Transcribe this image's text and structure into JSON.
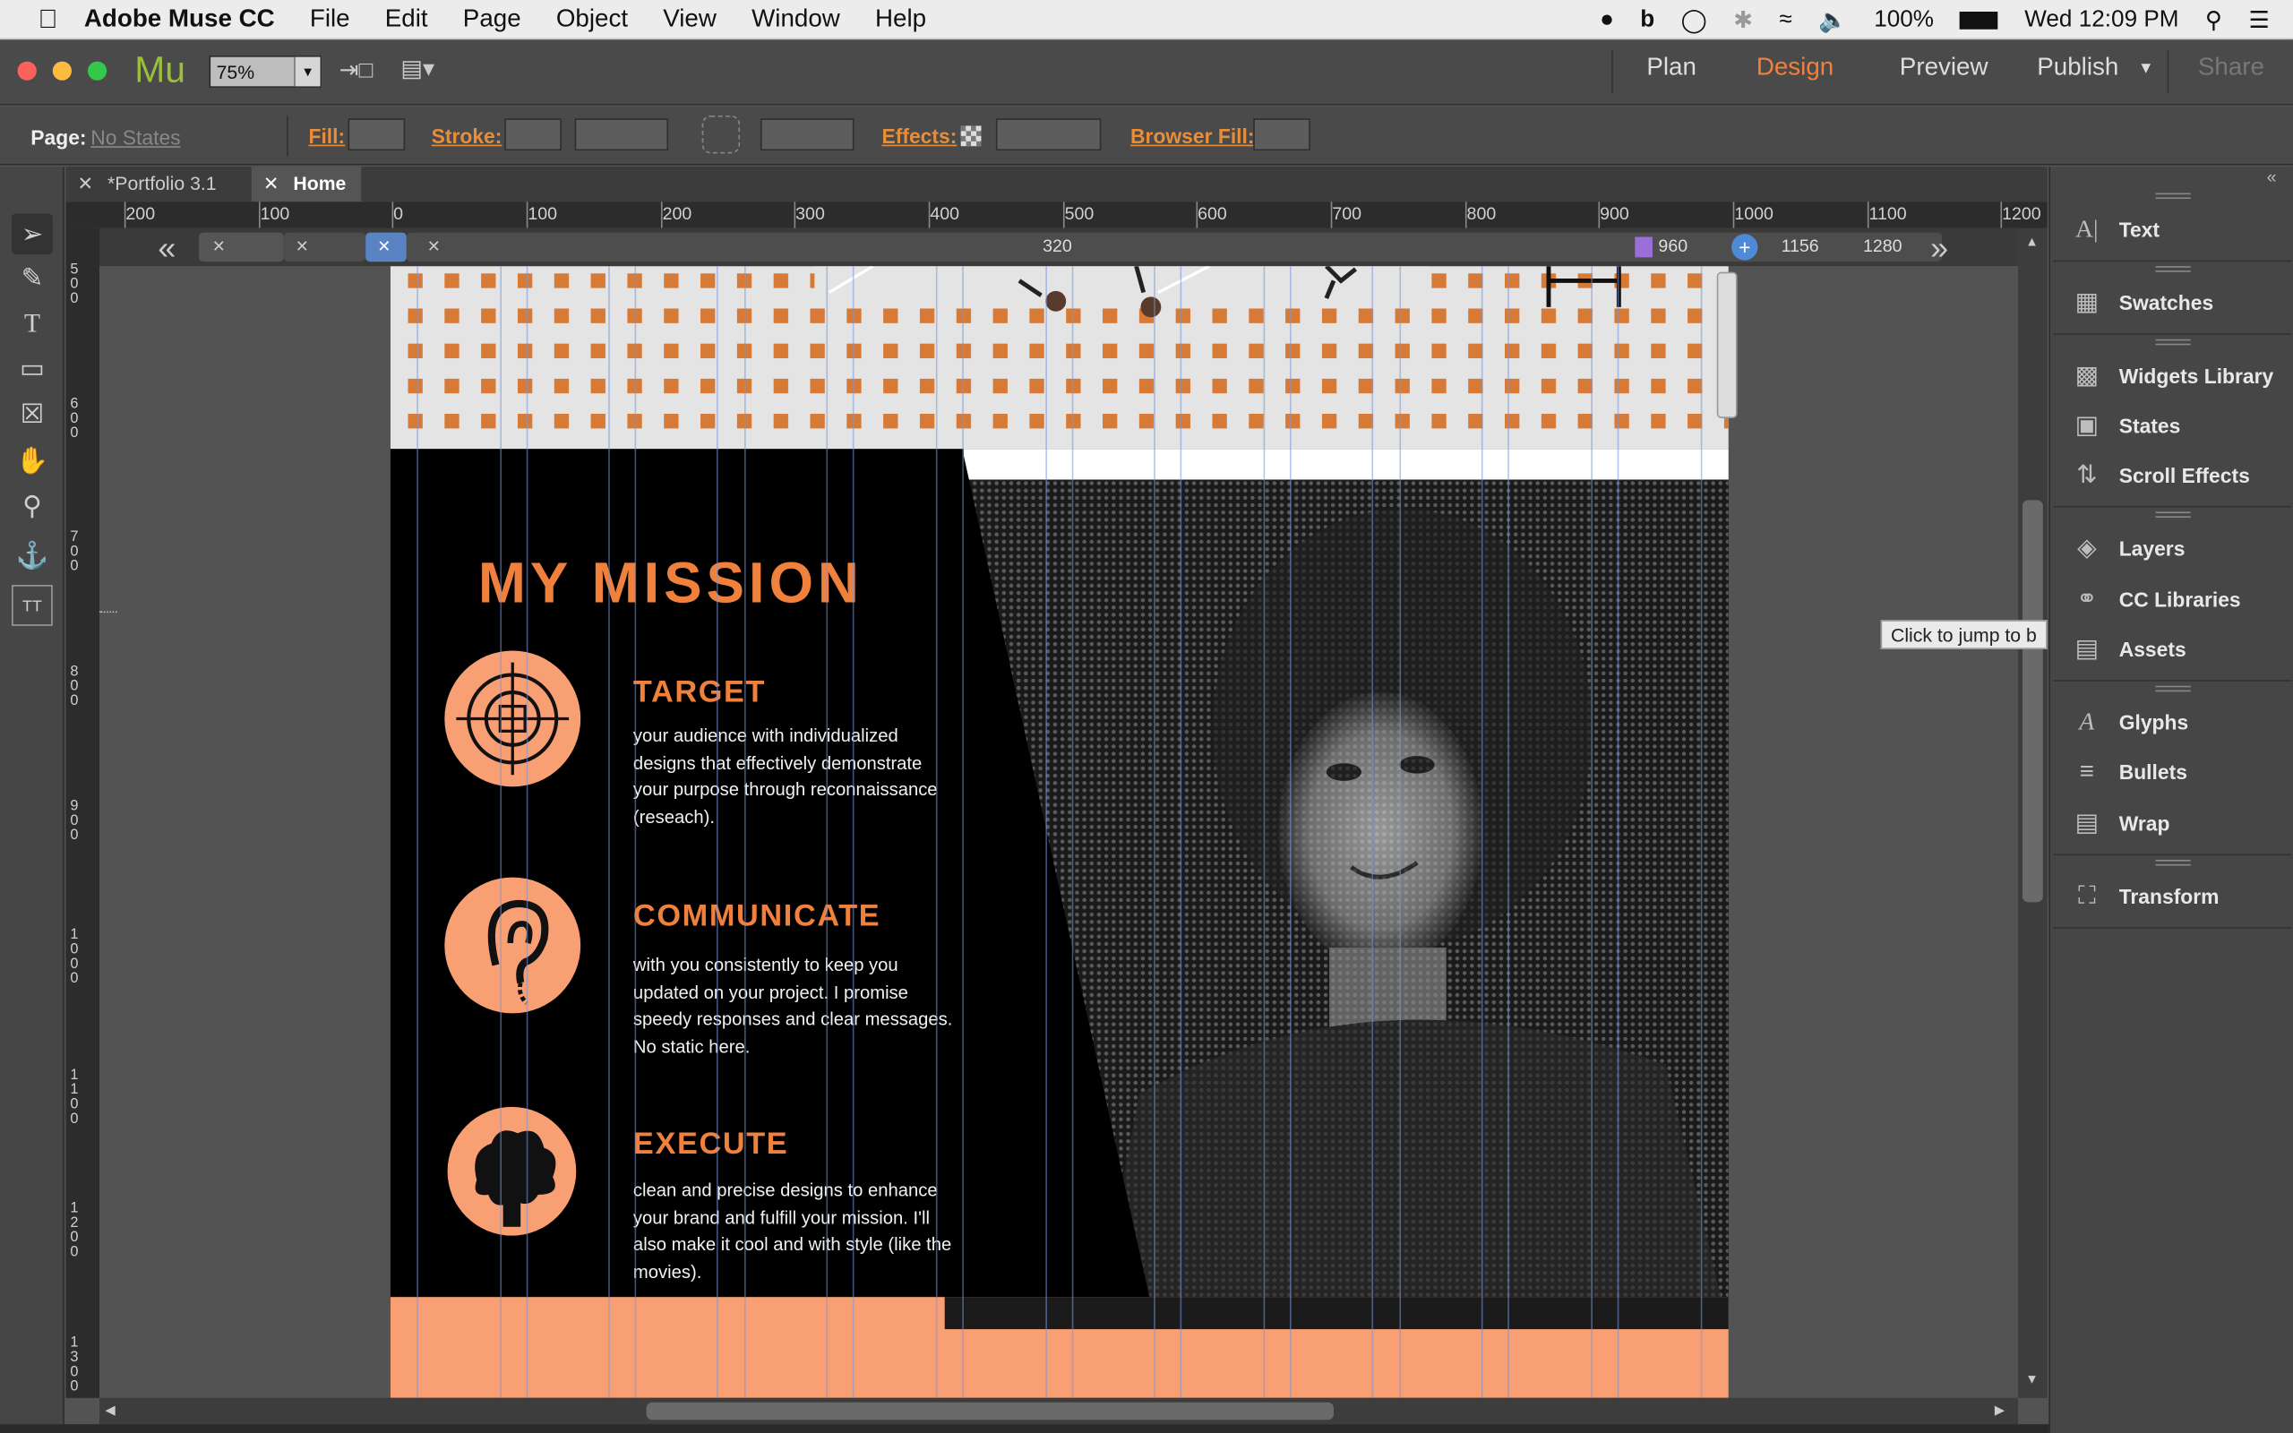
{
  "menubar": {
    "app_name": "Adobe Muse CC",
    "menus": [
      "File",
      "Edit",
      "Page",
      "Object",
      "View",
      "Window",
      "Help"
    ],
    "battery": "100%",
    "clock": "Wed 12:09 PM"
  },
  "toolbar": {
    "logo": "Mu",
    "zoom": "75%",
    "modes": [
      "Plan",
      "Design",
      "Preview",
      "Publish",
      "Share"
    ],
    "active_mode": "Design"
  },
  "control_bar": {
    "page_label": "Page:",
    "page_state": "No States",
    "fill_label": "Fill:",
    "stroke_label": "Stroke:",
    "effects_label": "Effects:",
    "browser_fill_label": "Browser Fill:"
  },
  "tabs": [
    {
      "label": "*Portfolio 3.1",
      "active": false
    },
    {
      "label": "Home",
      "active": true
    }
  ],
  "ruler": {
    "h_labels": [
      "200",
      "100",
      "0",
      "100",
      "200",
      "300",
      "400",
      "500",
      "600",
      "700",
      "800",
      "900",
      "1000",
      "1100",
      "1200"
    ],
    "v_labels": [
      "500",
      "600",
      "700",
      "800",
      "900",
      "1000",
      "1100",
      "1200",
      "1300"
    ]
  },
  "breakpoints": {
    "current": "320",
    "marks": [
      "960",
      "1156",
      "1280"
    ]
  },
  "page_content": {
    "title": "MY MISSION",
    "items": [
      {
        "heading": "TARGET",
        "text": "your audience with individualized designs that effectively demonstrate your purpose through reconnaissance (reseach)."
      },
      {
        "heading": "COMMUNICATE",
        "text": "with you consistently to keep you updated on your project. I promise speedy responses and clear messages. No static here."
      },
      {
        "heading": "EXECUTE",
        "text": "clean and precise designs to enhance your brand and fulfill your mission. I'll also make it cool and with style (like the movies)."
      }
    ]
  },
  "right_panel": {
    "items": [
      "Text",
      "Swatches",
      "Widgets Library",
      "States",
      "Scroll Effects",
      "Layers",
      "CC Libraries",
      "Assets",
      "Glyphs",
      "Bullets",
      "Wrap",
      "Transform"
    ]
  },
  "tooltip": "Click to jump to b",
  "colors": {
    "accent": "#f0813d",
    "peach": "#f8a074",
    "panel": "#464646"
  }
}
